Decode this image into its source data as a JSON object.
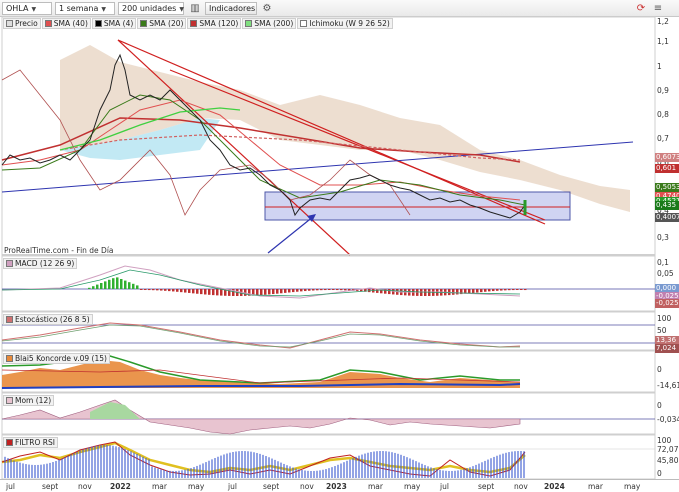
{
  "toolbar": {
    "symbol": "OHLA",
    "timeframe": "1 semana",
    "units": "200 unidades",
    "indicators_label": "Indicadores"
  },
  "price_panel": {
    "legend": [
      {
        "label": "Precio",
        "color": "#dddddd"
      },
      {
        "label": "SMA (40)",
        "color": "#e05050"
      },
      {
        "label": "SMA (4)",
        "color": "#000000"
      },
      {
        "label": "SMA (20)",
        "color": "#3a7a1a"
      },
      {
        "label": "SMA (120)",
        "color": "#c03030"
      },
      {
        "label": "SMA (200)",
        "color": "#80e080"
      },
      {
        "label": "Ichimoku (W 9 26 52)",
        "color": "#ffffff"
      }
    ],
    "credit": "ProRealTime.com - Fin de Día",
    "ticks": [
      "1,2",
      "1,1",
      "1",
      "0,9",
      "0,8",
      "0,7",
      "0,6",
      "0,5",
      "0,4",
      "0,3"
    ],
    "price_labels": [
      {
        "text": "0,6073",
        "color": "#d08080"
      },
      {
        "text": "0,601",
        "color": "#c03030"
      },
      {
        "text": "0,5053",
        "color": "#3a7a1a"
      },
      {
        "text": "0,4740",
        "color": "#e05050"
      },
      {
        "text": "0,4521",
        "color": "#2a9a2a"
      },
      {
        "text": "0,435",
        "color": "#1a7a1a"
      },
      {
        "text": "0,4007",
        "color": "#555555"
      }
    ]
  },
  "macd": {
    "legend": "MACD (12 26 9)",
    "ticks": [
      "0,1",
      "0,05",
      "0",
      "-0,05"
    ],
    "labels": [
      "0,000",
      "-0,025",
      "-0,025"
    ]
  },
  "stoch": {
    "legend": "Estocástico (26 8 5)",
    "ticks": [
      "100",
      "50",
      "0"
    ],
    "labels": [
      "13,36",
      "7,024"
    ]
  },
  "blai5": {
    "legend": "Blai5 Koncorde v.09 (15)",
    "ticks": [
      "0",
      "-14,61"
    ]
  },
  "mom": {
    "legend": "Mom (12)",
    "ticks": [
      "0",
      "-0,034"
    ]
  },
  "rsi": {
    "legend": "FILTRO RSI",
    "ticks": [
      "100",
      "72,07",
      "45,80",
      "0"
    ]
  },
  "x_axis": {
    "labels": [
      "jul",
      "sept",
      "nov",
      "2022",
      "mar",
      "may",
      "jul",
      "sept",
      "nov",
      "2023",
      "mar",
      "may",
      "jul",
      "sept",
      "nov",
      "2024",
      "mar",
      "may"
    ]
  }
}
